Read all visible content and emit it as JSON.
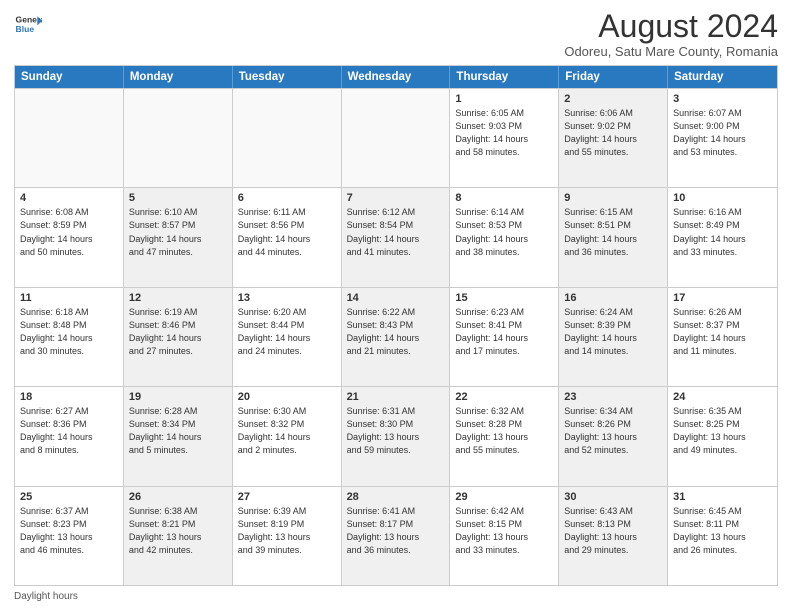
{
  "logo": {
    "line1": "General",
    "line2": "Blue"
  },
  "title": "August 2024",
  "subtitle": "Odoreu, Satu Mare County, Romania",
  "days_of_week": [
    "Sunday",
    "Monday",
    "Tuesday",
    "Wednesday",
    "Thursday",
    "Friday",
    "Saturday"
  ],
  "footer": "Daylight hours",
  "weeks": [
    [
      {
        "day": "",
        "detail": "",
        "shaded": false,
        "empty": true
      },
      {
        "day": "",
        "detail": "",
        "shaded": false,
        "empty": true
      },
      {
        "day": "",
        "detail": "",
        "shaded": false,
        "empty": true
      },
      {
        "day": "",
        "detail": "",
        "shaded": false,
        "empty": true
      },
      {
        "day": "1",
        "detail": "Sunrise: 6:05 AM\nSunset: 9:03 PM\nDaylight: 14 hours\nand 58 minutes.",
        "shaded": false,
        "empty": false
      },
      {
        "day": "2",
        "detail": "Sunrise: 6:06 AM\nSunset: 9:02 PM\nDaylight: 14 hours\nand 55 minutes.",
        "shaded": true,
        "empty": false
      },
      {
        "day": "3",
        "detail": "Sunrise: 6:07 AM\nSunset: 9:00 PM\nDaylight: 14 hours\nand 53 minutes.",
        "shaded": false,
        "empty": false
      }
    ],
    [
      {
        "day": "4",
        "detail": "Sunrise: 6:08 AM\nSunset: 8:59 PM\nDaylight: 14 hours\nand 50 minutes.",
        "shaded": false,
        "empty": false
      },
      {
        "day": "5",
        "detail": "Sunrise: 6:10 AM\nSunset: 8:57 PM\nDaylight: 14 hours\nand 47 minutes.",
        "shaded": true,
        "empty": false
      },
      {
        "day": "6",
        "detail": "Sunrise: 6:11 AM\nSunset: 8:56 PM\nDaylight: 14 hours\nand 44 minutes.",
        "shaded": false,
        "empty": false
      },
      {
        "day": "7",
        "detail": "Sunrise: 6:12 AM\nSunset: 8:54 PM\nDaylight: 14 hours\nand 41 minutes.",
        "shaded": true,
        "empty": false
      },
      {
        "day": "8",
        "detail": "Sunrise: 6:14 AM\nSunset: 8:53 PM\nDaylight: 14 hours\nand 38 minutes.",
        "shaded": false,
        "empty": false
      },
      {
        "day": "9",
        "detail": "Sunrise: 6:15 AM\nSunset: 8:51 PM\nDaylight: 14 hours\nand 36 minutes.",
        "shaded": true,
        "empty": false
      },
      {
        "day": "10",
        "detail": "Sunrise: 6:16 AM\nSunset: 8:49 PM\nDaylight: 14 hours\nand 33 minutes.",
        "shaded": false,
        "empty": false
      }
    ],
    [
      {
        "day": "11",
        "detail": "Sunrise: 6:18 AM\nSunset: 8:48 PM\nDaylight: 14 hours\nand 30 minutes.",
        "shaded": false,
        "empty": false
      },
      {
        "day": "12",
        "detail": "Sunrise: 6:19 AM\nSunset: 8:46 PM\nDaylight: 14 hours\nand 27 minutes.",
        "shaded": true,
        "empty": false
      },
      {
        "day": "13",
        "detail": "Sunrise: 6:20 AM\nSunset: 8:44 PM\nDaylight: 14 hours\nand 24 minutes.",
        "shaded": false,
        "empty": false
      },
      {
        "day": "14",
        "detail": "Sunrise: 6:22 AM\nSunset: 8:43 PM\nDaylight: 14 hours\nand 21 minutes.",
        "shaded": true,
        "empty": false
      },
      {
        "day": "15",
        "detail": "Sunrise: 6:23 AM\nSunset: 8:41 PM\nDaylight: 14 hours\nand 17 minutes.",
        "shaded": false,
        "empty": false
      },
      {
        "day": "16",
        "detail": "Sunrise: 6:24 AM\nSunset: 8:39 PM\nDaylight: 14 hours\nand 14 minutes.",
        "shaded": true,
        "empty": false
      },
      {
        "day": "17",
        "detail": "Sunrise: 6:26 AM\nSunset: 8:37 PM\nDaylight: 14 hours\nand 11 minutes.",
        "shaded": false,
        "empty": false
      }
    ],
    [
      {
        "day": "18",
        "detail": "Sunrise: 6:27 AM\nSunset: 8:36 PM\nDaylight: 14 hours\nand 8 minutes.",
        "shaded": false,
        "empty": false
      },
      {
        "day": "19",
        "detail": "Sunrise: 6:28 AM\nSunset: 8:34 PM\nDaylight: 14 hours\nand 5 minutes.",
        "shaded": true,
        "empty": false
      },
      {
        "day": "20",
        "detail": "Sunrise: 6:30 AM\nSunset: 8:32 PM\nDaylight: 14 hours\nand 2 minutes.",
        "shaded": false,
        "empty": false
      },
      {
        "day": "21",
        "detail": "Sunrise: 6:31 AM\nSunset: 8:30 PM\nDaylight: 13 hours\nand 59 minutes.",
        "shaded": true,
        "empty": false
      },
      {
        "day": "22",
        "detail": "Sunrise: 6:32 AM\nSunset: 8:28 PM\nDaylight: 13 hours\nand 55 minutes.",
        "shaded": false,
        "empty": false
      },
      {
        "day": "23",
        "detail": "Sunrise: 6:34 AM\nSunset: 8:26 PM\nDaylight: 13 hours\nand 52 minutes.",
        "shaded": true,
        "empty": false
      },
      {
        "day": "24",
        "detail": "Sunrise: 6:35 AM\nSunset: 8:25 PM\nDaylight: 13 hours\nand 49 minutes.",
        "shaded": false,
        "empty": false
      }
    ],
    [
      {
        "day": "25",
        "detail": "Sunrise: 6:37 AM\nSunset: 8:23 PM\nDaylight: 13 hours\nand 46 minutes.",
        "shaded": false,
        "empty": false
      },
      {
        "day": "26",
        "detail": "Sunrise: 6:38 AM\nSunset: 8:21 PM\nDaylight: 13 hours\nand 42 minutes.",
        "shaded": true,
        "empty": false
      },
      {
        "day": "27",
        "detail": "Sunrise: 6:39 AM\nSunset: 8:19 PM\nDaylight: 13 hours\nand 39 minutes.",
        "shaded": false,
        "empty": false
      },
      {
        "day": "28",
        "detail": "Sunrise: 6:41 AM\nSunset: 8:17 PM\nDaylight: 13 hours\nand 36 minutes.",
        "shaded": true,
        "empty": false
      },
      {
        "day": "29",
        "detail": "Sunrise: 6:42 AM\nSunset: 8:15 PM\nDaylight: 13 hours\nand 33 minutes.",
        "shaded": false,
        "empty": false
      },
      {
        "day": "30",
        "detail": "Sunrise: 6:43 AM\nSunset: 8:13 PM\nDaylight: 13 hours\nand 29 minutes.",
        "shaded": true,
        "empty": false
      },
      {
        "day": "31",
        "detail": "Sunrise: 6:45 AM\nSunset: 8:11 PM\nDaylight: 13 hours\nand 26 minutes.",
        "shaded": false,
        "empty": false
      }
    ]
  ]
}
